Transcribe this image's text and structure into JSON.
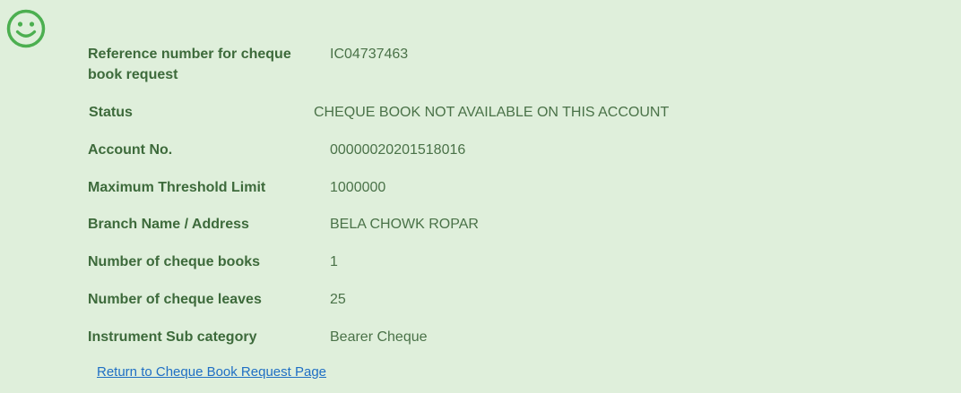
{
  "icon": {
    "name": "smiley-face-icon",
    "color": "#4caf50"
  },
  "details": {
    "reference": {
      "label": "Reference number for cheque book request",
      "value": "IC04737463"
    },
    "status": {
      "label": "Status",
      "value": "CHEQUE BOOK NOT AVAILABLE ON THIS ACCOUNT"
    },
    "account": {
      "label": "Account No.",
      "value": "00000020201518016"
    },
    "threshold": {
      "label": "Maximum Threshold Limit",
      "value": "1000000"
    },
    "branch": {
      "label": "Branch Name / Address",
      "value": "BELA CHOWK ROPAR"
    },
    "books": {
      "label": "Number of cheque books",
      "value": "1"
    },
    "leaves": {
      "label": "Number of cheque leaves",
      "value": "25"
    },
    "subcategory": {
      "label": "Instrument Sub category",
      "value": "Bearer Cheque"
    }
  },
  "links": {
    "return_label": "Return to Cheque Book Request Page"
  }
}
